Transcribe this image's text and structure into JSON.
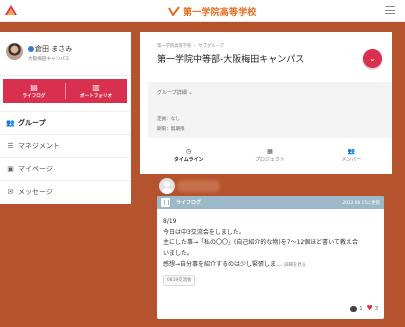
{
  "header": {
    "brand_name": "第一学院高等学校",
    "brand_color": "#e36a1e"
  },
  "sidebar": {
    "user_name": "倉田 まさみ",
    "user_campus": "大阪梅田キャンパス",
    "quick_tiles": [
      {
        "label": "ライフログ",
        "icon": "book-icon"
      },
      {
        "label": "ポートフォリオ",
        "icon": "open-book-icon"
      }
    ],
    "menu": [
      {
        "label": "グループ",
        "icon": "users-icon",
        "active": true
      },
      {
        "label": "マネジメント",
        "icon": "list-icon"
      },
      {
        "label": "マイページ",
        "icon": "profile-card-icon"
      },
      {
        "label": "メッセージ",
        "icon": "envelope-icon"
      }
    ]
  },
  "group": {
    "breadcrumb": "第一学院高等学校 ・ サブグループ",
    "title": "第一学院中等部-大阪梅田キャンパス",
    "details_toggle": "グループ詳細",
    "capacity": "定員：なし",
    "period": "期限：無期限"
  },
  "tabs": [
    {
      "label": "タイムライン",
      "icon": "clock-icon",
      "active": true
    },
    {
      "label": "プロジェクト",
      "icon": "document-icon"
    },
    {
      "label": "メンバー",
      "icon": "members-icon"
    }
  ],
  "post": {
    "type_label": "ライフログ",
    "date": "2022.08.15に更新",
    "lines": [
      "8/19",
      "今日は中3交流会をしました。",
      "主にした事→「私の〇〇」(自己紹介的な物)を7〜12個ほど書いて教え合",
      "いました。",
      "感想→自分事を紹介するのは少し緊張しま…"
    ],
    "more_label": "詳細を見る",
    "tag": "0819交流会",
    "comment_count": "1",
    "like_count": "3"
  },
  "colors": {
    "background": "#b5532e",
    "accent": "#d8304e",
    "card_header": "#9cb8c9"
  }
}
